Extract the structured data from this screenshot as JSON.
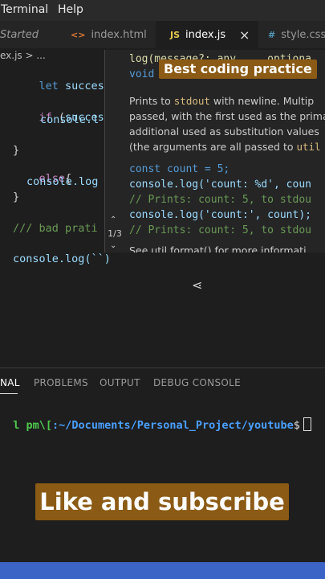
{
  "menubar": {
    "items": [
      "Terminal",
      "Help"
    ]
  },
  "tabs": [
    {
      "label": "Started",
      "icon": "",
      "active": false
    },
    {
      "label": "index.html",
      "icon": "<>",
      "active": false
    },
    {
      "label": "index.js",
      "icon": "JS",
      "active": true
    },
    {
      "label": "style.css",
      "icon": "#",
      "active": false
    }
  ],
  "tab_close_symbol": "×",
  "breadcrumb": "ex.js > ...",
  "colors": {
    "accent": "#3c63c6",
    "overlay": "#8b5a14",
    "js_yellow": "#e6c84f",
    "html_orange": "#e37933",
    "css_blue": "#519aba"
  },
  "editor": {
    "l1": {
      "kw": "let",
      "rest": " success=f"
    },
    "l2": {
      "kw": "if",
      "p1": " (",
      "var": "success",
      "p2": ")"
    },
    "l3": "console.l",
    "l4": "}",
    "l5": {
      "kw": "else",
      "p": "{"
    },
    "l6": "console.log",
    "l7": "}",
    "l8": "/// bad prati",
    "l9": "console.log(``)"
  },
  "hover": {
    "counter": "1/3",
    "sig1": "log(message?: any, ...optiona",
    "sig2": "void",
    "doc1_a": "Prints to ",
    "doc1_code": "stdout",
    "doc1_b": " with newline. Multip",
    "doc2": "passed, with the first used as the prima",
    "doc3": "additional used as substitution values",
    "doc4_a": "(the arguments are all passed to ",
    "doc4_code": "util",
    "code1": "const count = 5;",
    "code2": "console.log('count: %d', coun",
    "code3": "// Prints: count: 5, to stdou",
    "code4": "console.log('count:', count);",
    "code5": "// Prints: count: 5, to stdou",
    "more": "See util.format() for more informati"
  },
  "overlay": {
    "top": "Best coding practice",
    "bottom": "Like and subscribe"
  },
  "panel": {
    "tabs": [
      "NAL",
      "PROBLEMS",
      "OUTPUT",
      "DEBUG CONSOLE"
    ],
    "prompt_a": "l pm\\[",
    "prompt_b": ":~/Documents/Personal_Project/youtube",
    "prompt_c": "$"
  }
}
